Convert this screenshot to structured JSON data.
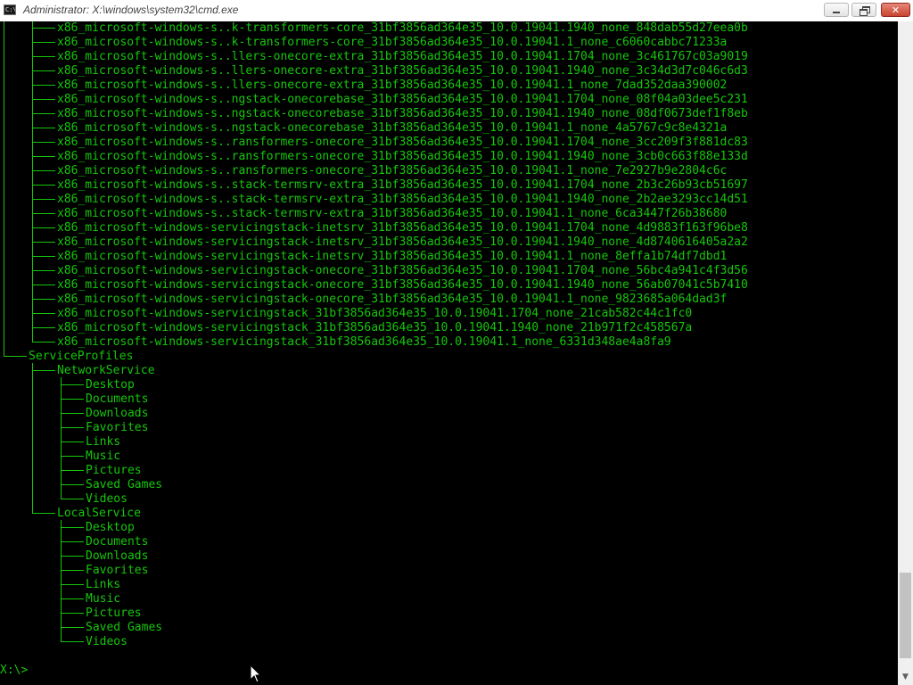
{
  "window": {
    "title": "Administrator: X:\\windows\\system32\\cmd.exe",
    "app_icon_text": "C:\\",
    "minimize_icon": "minimize-icon",
    "maximize_icon": "restore-icon",
    "close_symbol": "✕"
  },
  "console": {
    "text_color": "#16c60c",
    "background": "#000000",
    "lines": [
      {
        "depth": 2,
        "text": "x86_microsoft-windows-s..k-transformers-core_31bf3856ad364e35_10.0.19041.1940_none_848dab55d27eea0b"
      },
      {
        "depth": 2,
        "text": "x86_microsoft-windows-s..k-transformers-core_31bf3856ad364e35_10.0.19041.1_none_c6060cabbc71233a"
      },
      {
        "depth": 2,
        "text": "x86_microsoft-windows-s..llers-onecore-extra_31bf3856ad364e35_10.0.19041.1704_none_3c461767c03a9019"
      },
      {
        "depth": 2,
        "text": "x86_microsoft-windows-s..llers-onecore-extra_31bf3856ad364e35_10.0.19041.1940_none_3c34d3d7c046c6d3"
      },
      {
        "depth": 2,
        "text": "x86_microsoft-windows-s..llers-onecore-extra_31bf3856ad364e35_10.0.19041.1_none_7dad352daa390002"
      },
      {
        "depth": 2,
        "text": "x86_microsoft-windows-s..ngstack-onecorebase_31bf3856ad364e35_10.0.19041.1704_none_08f04a03dee5c231"
      },
      {
        "depth": 2,
        "text": "x86_microsoft-windows-s..ngstack-onecorebase_31bf3856ad364e35_10.0.19041.1940_none_08df0673def1f8eb"
      },
      {
        "depth": 2,
        "text": "x86_microsoft-windows-s..ngstack-onecorebase_31bf3856ad364e35_10.0.19041.1_none_4a5767c9c8e4321a"
      },
      {
        "depth": 2,
        "text": "x86_microsoft-windows-s..ransformers-onecore_31bf3856ad364e35_10.0.19041.1704_none_3cc209f3f881dc83"
      },
      {
        "depth": 2,
        "text": "x86_microsoft-windows-s..ransformers-onecore_31bf3856ad364e35_10.0.19041.1940_none_3cb0c663f88e133d"
      },
      {
        "depth": 2,
        "text": "x86_microsoft-windows-s..ransformers-onecore_31bf3856ad364e35_10.0.19041.1_none_7e2927b9e2804c6c"
      },
      {
        "depth": 2,
        "text": "x86_microsoft-windows-s..stack-termsrv-extra_31bf3856ad364e35_10.0.19041.1704_none_2b3c26b93cb51697"
      },
      {
        "depth": 2,
        "text": "x86_microsoft-windows-s..stack-termsrv-extra_31bf3856ad364e35_10.0.19041.1940_none_2b2ae3293cc14d51"
      },
      {
        "depth": 2,
        "text": "x86_microsoft-windows-s..stack-termsrv-extra_31bf3856ad364e35_10.0.19041.1_none_6ca3447f26b38680"
      },
      {
        "depth": 2,
        "text": "x86_microsoft-windows-servicingstack-inetsrv_31bf3856ad364e35_10.0.19041.1704_none_4d9883f163f96be8"
      },
      {
        "depth": 2,
        "text": "x86_microsoft-windows-servicingstack-inetsrv_31bf3856ad364e35_10.0.19041.1940_none_4d8740616405a2a2"
      },
      {
        "depth": 2,
        "text": "x86_microsoft-windows-servicingstack-inetsrv_31bf3856ad364e35_10.0.19041.1_none_8effa1b74df7dbd1"
      },
      {
        "depth": 2,
        "text": "x86_microsoft-windows-servicingstack-onecore_31bf3856ad364e35_10.0.19041.1704_none_56bc4a941c4f3d56"
      },
      {
        "depth": 2,
        "text": "x86_microsoft-windows-servicingstack-onecore_31bf3856ad364e35_10.0.19041.1940_none_56ab07041c5b7410"
      },
      {
        "depth": 2,
        "text": "x86_microsoft-windows-servicingstack-onecore_31bf3856ad364e35_10.0.19041.1_none_9823685a064dad3f"
      },
      {
        "depth": 2,
        "text": "x86_microsoft-windows-servicingstack_31bf3856ad364e35_10.0.19041.1704_none_21cab582c44c1fc0"
      },
      {
        "depth": 2,
        "text": "x86_microsoft-windows-servicingstack_31bf3856ad364e35_10.0.19041.1940_none_21b971f2c458567a"
      },
      {
        "depth": 2,
        "text": "x86_microsoft-windows-servicingstack_31bf3856ad364e35_10.0.19041.1_none_6331d348ae4a8fa9"
      },
      {
        "depth": 1,
        "text": "ServiceProfiles"
      },
      {
        "depth": 2,
        "text": "NetworkService"
      },
      {
        "depth": 3,
        "text": "Desktop"
      },
      {
        "depth": 3,
        "text": "Documents"
      },
      {
        "depth": 3,
        "text": "Downloads"
      },
      {
        "depth": 3,
        "text": "Favorites"
      },
      {
        "depth": 3,
        "text": "Links"
      },
      {
        "depth": 3,
        "text": "Music"
      },
      {
        "depth": 3,
        "text": "Pictures"
      },
      {
        "depth": 3,
        "text": "Saved Games"
      },
      {
        "depth": 3,
        "text": "Videos"
      },
      {
        "depth": 2,
        "text": "LocalService"
      },
      {
        "depth": 3,
        "text": "Desktop"
      },
      {
        "depth": 3,
        "text": "Documents"
      },
      {
        "depth": 3,
        "text": "Downloads"
      },
      {
        "depth": 3,
        "text": "Favorites"
      },
      {
        "depth": 3,
        "text": "Links"
      },
      {
        "depth": 3,
        "text": "Music"
      },
      {
        "depth": 3,
        "text": "Pictures"
      },
      {
        "depth": 3,
        "text": "Saved Games"
      },
      {
        "depth": 3,
        "text": "Videos"
      }
    ],
    "prompt": "X:\\>"
  },
  "scrollbar": {
    "down_arrow": "▼",
    "scroll_position_fraction": 0.96
  }
}
